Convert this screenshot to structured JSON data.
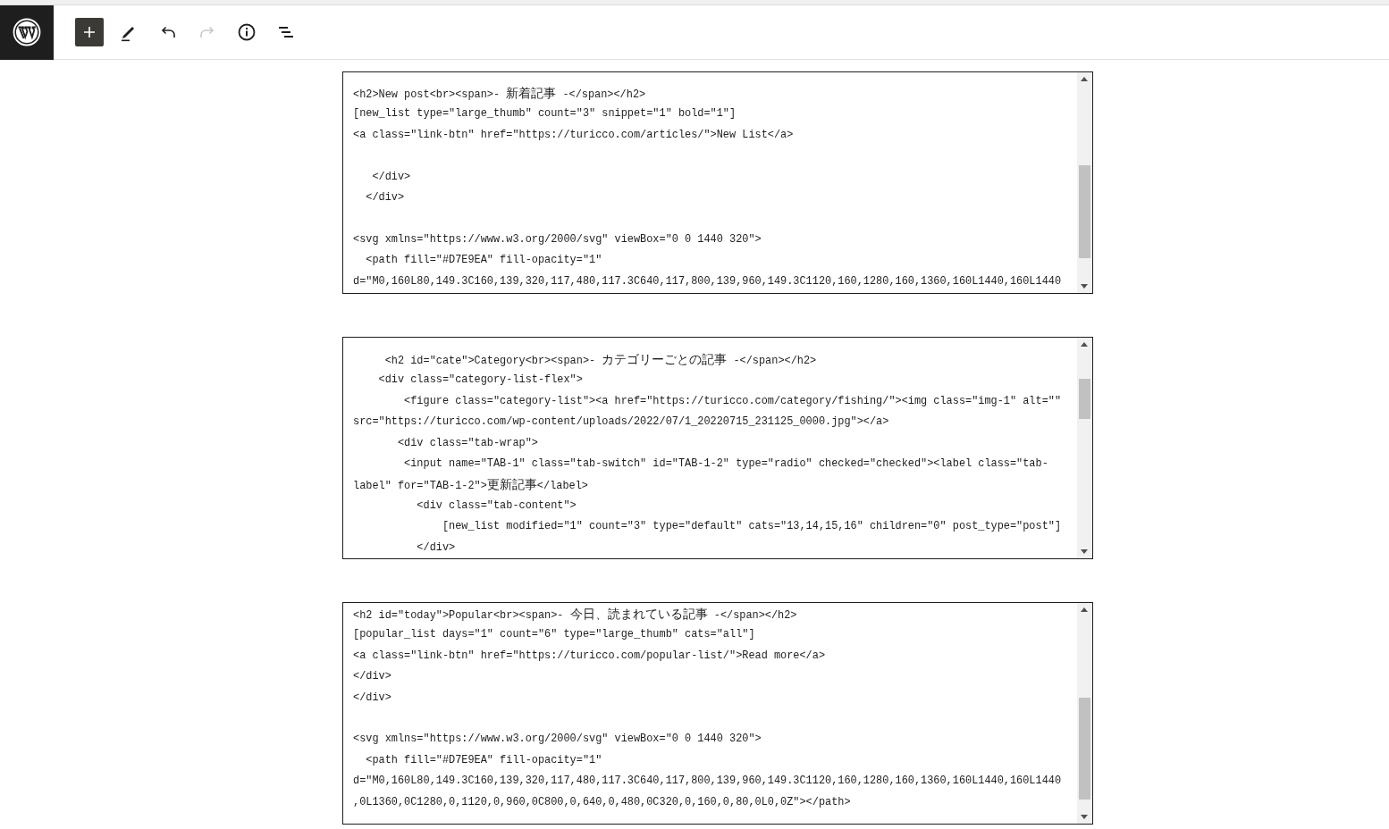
{
  "toolbar": [
    {
      "kind": "add",
      "disabled": false
    },
    {
      "kind": "edit",
      "disabled": false
    },
    {
      "kind": "undo",
      "disabled": false
    },
    {
      "kind": "redo",
      "disabled": true
    },
    {
      "kind": "info",
      "disabled": false
    },
    {
      "kind": "outline",
      "disabled": false
    }
  ],
  "code_blocks": [
    {
      "groups": [
        [
          "<h2>New post<br><span>- 新着記事 -</span></h2>",
          "[new_list type=\"large_thumb\" count=\"3\" snippet=\"1\" bold=\"1\"]",
          "<a class=\"link-btn\" href=\"https://turicco.com/articles/\">New List</a>"
        ],
        [
          "   </div>",
          "  </div>"
        ],
        [
          "<svg xmlns=\"https://www.w3.org/2000/svg\" viewBox=\"0 0 1440 320\">",
          "  <path fill=\"#D7E9EA\" fill-opacity=\"1\"",
          "d=\"M0,160L80,149.3C160,139,320,117,480,117.3C640,117,800,139,960,149.3C1120,160,1280,160,1360,160L1440,160L1440"
        ]
      ]
    },
    {
      "groups": [
        [
          "     <h2 id=\"cate\">Category<br><span>- カテゴリーごとの記事 -</span></h2>",
          "    <div class=\"category-list-flex\">",
          "        <figure class=\"category-list\"><a href=\"https://turicco.com/category/fishing/\"><img class=\"img-1\" alt=\"\"",
          "src=\"https://turicco.com/wp-content/uploads/2022/07/1_20220715_231125_0000.jpg\"></a>",
          "       <div class=\"tab-wrap\">",
          "        <input name=\"TAB-1\" class=\"tab-switch\" id=\"TAB-1-2\" type=\"radio\" checked=\"checked\"><label class=\"tab-",
          "label\" for=\"TAB-1-2\">更新記事</label>",
          "          <div class=\"tab-content\">",
          "              [new_list modified=\"1\" count=\"3\" type=\"default\" cats=\"13,14,15,16\" children=\"0\" post_type=\"post\"]",
          "          </div>"
        ]
      ]
    },
    {
      "groups": [
        [
          "<h2 id=\"today\">Popular<br><span>- 今日、読まれている記事 -</span></h2>",
          "[popular_list days=\"1\" count=\"6\" type=\"large_thumb\" cats=\"all\"]",
          "<a class=\"link-btn\" href=\"https://turicco.com/popular-list/\">Read more</a>",
          "</div>",
          "</div>"
        ],
        [
          "<svg xmlns=\"https://www.w3.org/2000/svg\" viewBox=\"0 0 1440 320\">",
          "  <path fill=\"#D7E9EA\" fill-opacity=\"1\"",
          "d=\"M0,160L80,149.3C160,139,320,117,480,117.3C640,117,800,139,960,149.3C1120,160,1280,160,1360,160L1440,160L1440",
          ",0L1360,0C1280,0,1120,0,960,0C800,0,640,0,480,0C320,0,160,0,80,0L0,0Z\"></path>"
        ]
      ]
    }
  ]
}
